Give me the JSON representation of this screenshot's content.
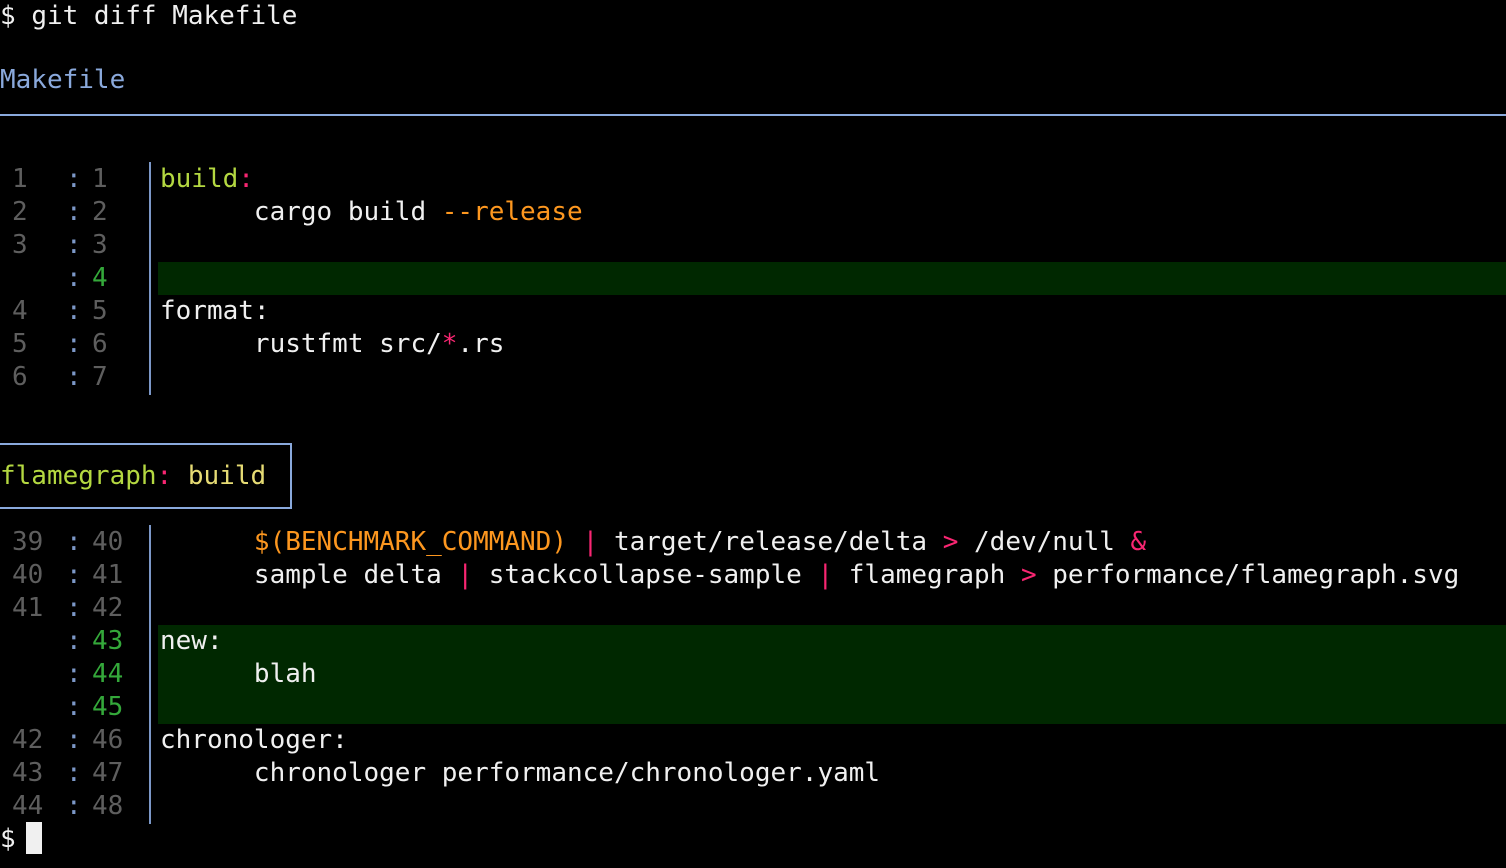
{
  "prompt": {
    "symbol": "$",
    "command": "git diff Makefile"
  },
  "file": {
    "name": "Makefile"
  },
  "hunks": [
    {
      "header": null,
      "rows": [
        {
          "old": "1",
          "new": "1",
          "added": false,
          "segments": [
            {
              "t": "build",
              "c": "target"
            },
            {
              "t": ":",
              "c": "punct"
            }
          ]
        },
        {
          "old": "2",
          "new": "2",
          "added": false,
          "segments": [
            {
              "t": "      cargo build ",
              "c": ""
            },
            {
              "t": "--release",
              "c": "opt"
            }
          ]
        },
        {
          "old": "3",
          "new": "3",
          "added": false,
          "segments": []
        },
        {
          "old": "",
          "new": "4",
          "added": true,
          "segments": []
        },
        {
          "old": "4",
          "new": "5",
          "added": false,
          "segments": [
            {
              "t": "format:",
              "c": ""
            }
          ]
        },
        {
          "old": "5",
          "new": "6",
          "added": false,
          "segments": [
            {
              "t": "      rustfmt src/",
              "c": ""
            },
            {
              "t": "*",
              "c": "punct"
            },
            {
              "t": ".rs",
              "c": ""
            }
          ]
        },
        {
          "old": "6",
          "new": "7",
          "added": false,
          "segments": []
        }
      ]
    },
    {
      "header": {
        "name": "flamegraph",
        "colon": ":",
        "dep": " build"
      },
      "rows": [
        {
          "old": "39",
          "new": "40",
          "added": false,
          "segments": [
            {
              "t": "      ",
              "c": ""
            },
            {
              "t": "$(BENCHMARK_COMMAND)",
              "c": "var"
            },
            {
              "t": " | ",
              "c": "punct"
            },
            {
              "t": "target/release/delta ",
              "c": ""
            },
            {
              "t": ">",
              "c": "punct"
            },
            {
              "t": " /dev/null ",
              "c": ""
            },
            {
              "t": "&",
              "c": "punct"
            }
          ]
        },
        {
          "old": "40",
          "new": "41",
          "added": false,
          "segments": [
            {
              "t": "      sample delta ",
              "c": ""
            },
            {
              "t": "|",
              "c": "punct"
            },
            {
              "t": " stackcollapse-sample ",
              "c": ""
            },
            {
              "t": "|",
              "c": "punct"
            },
            {
              "t": " flamegraph ",
              "c": ""
            },
            {
              "t": ">",
              "c": "punct"
            },
            {
              "t": " performance/flamegraph.svg",
              "c": ""
            }
          ]
        },
        {
          "old": "41",
          "new": "42",
          "added": false,
          "segments": []
        },
        {
          "old": "",
          "new": "43",
          "added": true,
          "segments": [
            {
              "t": "new:",
              "c": ""
            }
          ]
        },
        {
          "old": "",
          "new": "44",
          "added": true,
          "segments": [
            {
              "t": "      blah",
              "c": ""
            }
          ]
        },
        {
          "old": "",
          "new": "45",
          "added": true,
          "segments": []
        },
        {
          "old": "42",
          "new": "46",
          "added": false,
          "segments": [
            {
              "t": "chronologer:",
              "c": ""
            }
          ]
        },
        {
          "old": "43",
          "new": "47",
          "added": false,
          "segments": [
            {
              "t": "      chronologer performance/chronologer.yaml",
              "c": ""
            }
          ]
        },
        {
          "old": "44",
          "new": "48",
          "added": false,
          "segments": []
        }
      ]
    }
  ],
  "separator": ":",
  "end_prompt": {
    "symbol": "$"
  },
  "colors": {
    "background": "#000000",
    "foreground": "#f0f0f0",
    "file_header": "#8aa9dc",
    "added_bg": "#002800",
    "added_line_number": "#34a83a",
    "line_number": "#5e5e5e",
    "target": "#b4d841",
    "operator": "#f92672",
    "option": "#fd971f",
    "dependency": "#e6db74"
  }
}
